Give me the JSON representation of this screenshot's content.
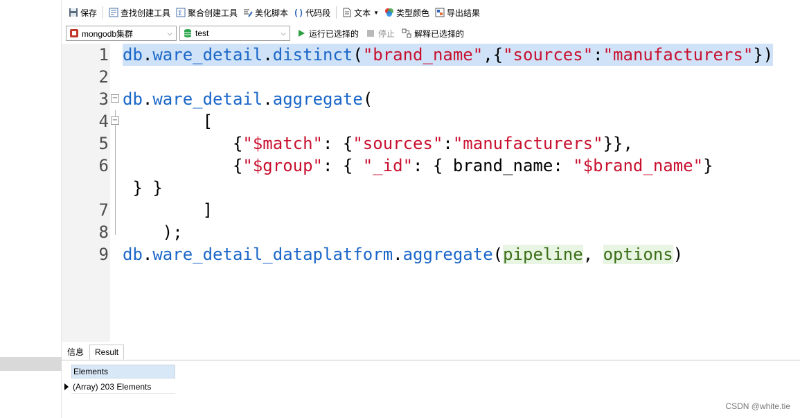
{
  "toolbar": {
    "save": "保存",
    "query_builder": "查找创建工具",
    "aggregate_builder": "聚合创建工具",
    "beautify": "美化脚本",
    "code_snippet": "代码段",
    "text": "文本",
    "type_color": "类型颜色",
    "export": "导出结果"
  },
  "connection_bar": {
    "connection": "mongodb集群",
    "database": "test",
    "run_selected": "运行已选择的",
    "stop": "停止",
    "explain_selected": "解释已选择的"
  },
  "editor": {
    "lines": [
      {
        "num": "1",
        "segments": [
          [
            "obj",
            "db"
          ],
          [
            "pl",
            "."
          ],
          [
            "obj",
            "ware_detail"
          ],
          [
            "pl",
            "."
          ],
          [
            "fn",
            "distinct"
          ],
          [
            "pl",
            "("
          ],
          [
            "str",
            "\"brand_name\""
          ],
          [
            "pl",
            ",{"
          ],
          [
            "str",
            "\"sources\""
          ],
          [
            "pl",
            ":"
          ],
          [
            "str",
            "\"manufacturers\""
          ],
          [
            "pl",
            "})"
          ]
        ]
      },
      {
        "num": "2",
        "segments": []
      },
      {
        "num": "3",
        "segments": [
          [
            "obj",
            "db"
          ],
          [
            "pl",
            "."
          ],
          [
            "obj",
            "ware_detail"
          ],
          [
            "pl",
            "."
          ],
          [
            "fn",
            "aggregate"
          ],
          [
            "pl",
            "("
          ]
        ]
      },
      {
        "num": "4",
        "segments": [
          [
            "pl",
            "        ["
          ]
        ]
      },
      {
        "num": "5",
        "segments": [
          [
            "pl",
            "           {"
          ],
          [
            "str",
            "\"$match\""
          ],
          [
            "pl",
            ": {"
          ],
          [
            "str",
            "\"sources\""
          ],
          [
            "pl",
            ":"
          ],
          [
            "str",
            "\"manufacturers\""
          ],
          [
            "pl",
            "}},"
          ]
        ]
      },
      {
        "num": "6",
        "segments": [
          [
            "pl",
            "           {"
          ],
          [
            "str",
            "\"$group\""
          ],
          [
            "pl",
            ": { "
          ],
          [
            "str",
            "\"_id\""
          ],
          [
            "pl",
            ": { brand_name: "
          ],
          [
            "str",
            "\"$brand_name\""
          ],
          [
            "pl",
            "}"
          ]
        ]
      },
      {
        "num": "",
        "segments": [
          [
            "pl",
            " } }"
          ]
        ]
      },
      {
        "num": "7",
        "segments": [
          [
            "pl",
            "        ]"
          ]
        ]
      },
      {
        "num": "8",
        "segments": [
          [
            "pl",
            "    );"
          ]
        ]
      },
      {
        "num": "9",
        "segments": [
          [
            "obj",
            "db"
          ],
          [
            "pl",
            "."
          ],
          [
            "obj",
            "ware_detail_dataplatform"
          ],
          [
            "pl",
            "."
          ],
          [
            "fn",
            "aggregate"
          ],
          [
            "pl",
            "("
          ],
          [
            "param",
            "pipeline"
          ],
          [
            "pl",
            ", "
          ],
          [
            "param",
            "options"
          ],
          [
            "pl",
            ")"
          ]
        ]
      }
    ]
  },
  "bottom_tabs": {
    "info": "信息",
    "result": "Result"
  },
  "result": {
    "column_header": "Elements",
    "row_value": "(Array) 203 Elements"
  },
  "credit": "CSDN @white.tie",
  "colors": {
    "selection": "#cfe2f7",
    "keyword": "#1a66c8",
    "string": "#c8102e",
    "param": "#3b6e17"
  }
}
